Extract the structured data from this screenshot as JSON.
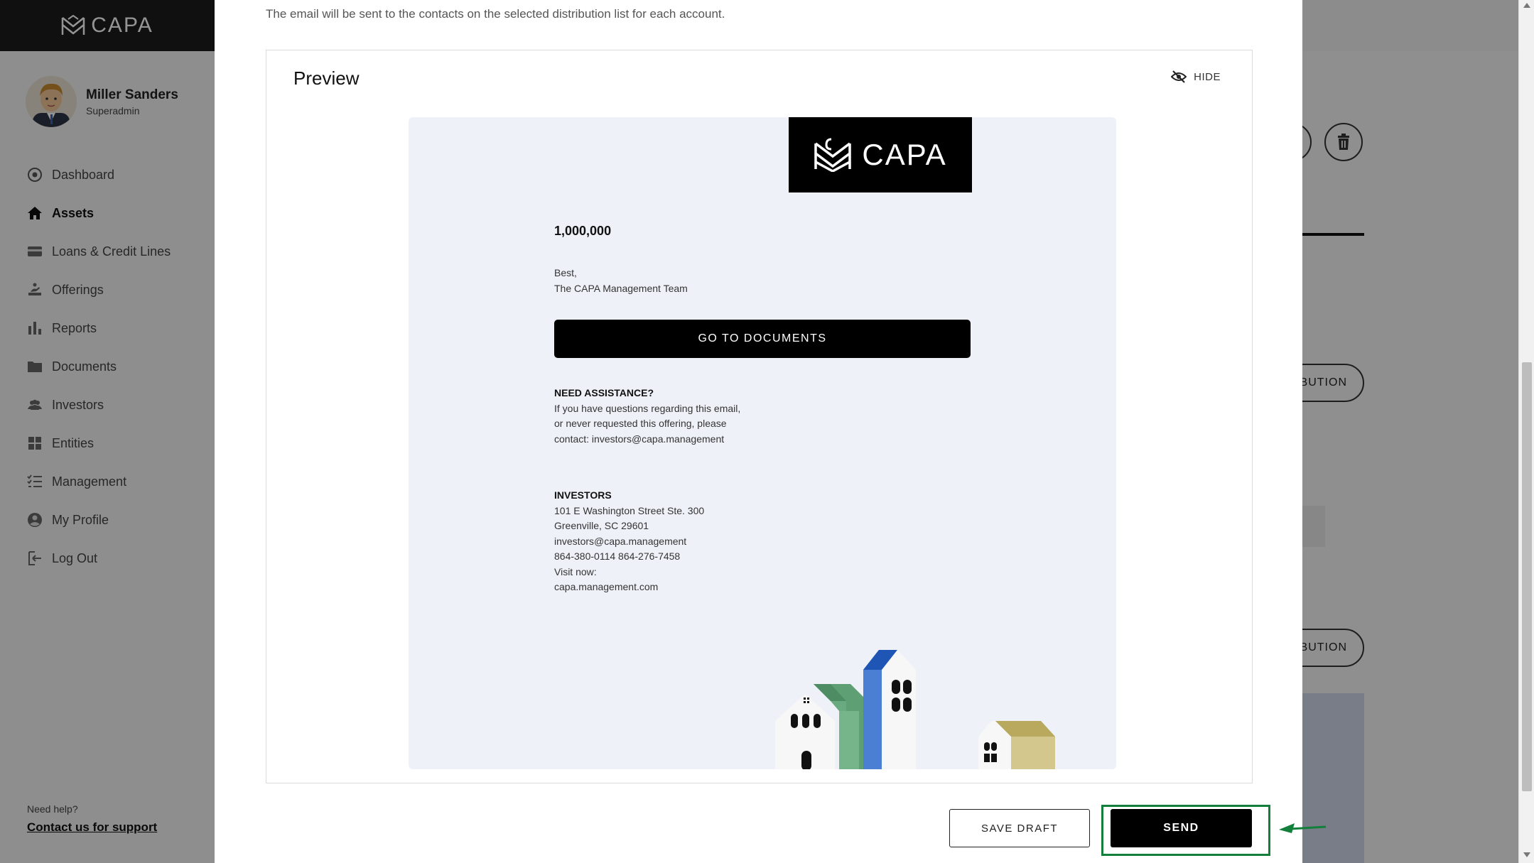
{
  "app": {
    "brand": "CAPA"
  },
  "user": {
    "name": "Miller Sanders",
    "role": "Superadmin"
  },
  "sidebar": {
    "items": [
      {
        "label": "Dashboard",
        "icon": "dashboard-icon"
      },
      {
        "label": "Assets",
        "icon": "home-icon",
        "active": true
      },
      {
        "label": "Loans & Credit Lines",
        "icon": "credit-card-icon"
      },
      {
        "label": "Offerings",
        "icon": "offering-icon"
      },
      {
        "label": "Reports",
        "icon": "bar-chart-icon"
      },
      {
        "label": "Documents",
        "icon": "folder-icon"
      },
      {
        "label": "Investors",
        "icon": "people-icon"
      },
      {
        "label": "Entities",
        "icon": "grid-icon"
      },
      {
        "label": "Management",
        "icon": "checklist-icon"
      },
      {
        "label": "My Profile",
        "icon": "user-circle-icon"
      },
      {
        "label": "Log Out",
        "icon": "logout-icon"
      }
    ],
    "help_text": "Need help?",
    "support_link": "Contact us for support"
  },
  "background": {
    "pill_1": "BUTION",
    "pill_2": "BUTION"
  },
  "modal": {
    "description": "The email will be sent to the contacts on the selected distribution list for each account.",
    "preview_title": "Preview",
    "hide_label": "HIDE",
    "email": {
      "logo_text": "CAPA",
      "amount": "1,000,000",
      "signoff_1": "Best,",
      "signoff_2": "The CAPA Management Team",
      "cta_label": "GO TO DOCUMENTS",
      "assist_heading": "NEED ASSISTANCE?",
      "assist_body": "If you have questions regarding this email, or never requested this offering, please contact: investors@capa.management",
      "investors_heading": "INVESTORS",
      "address_1": "101 E Washington Street Ste. 300",
      "address_2": "Greenville, SC 29601",
      "email_addr": "investors@capa.management",
      "phones": "864-380-0114 864-276-7458",
      "visit_label": "Visit now:",
      "website": "capa.management.com"
    },
    "save_draft_label": "SAVE DRAFT",
    "send_label": "SEND"
  },
  "colors": {
    "highlight": "#12803a",
    "building_blue": "#4a7fd4",
    "building_green": "#6aaa80",
    "building_gold": "#d3c78e"
  }
}
